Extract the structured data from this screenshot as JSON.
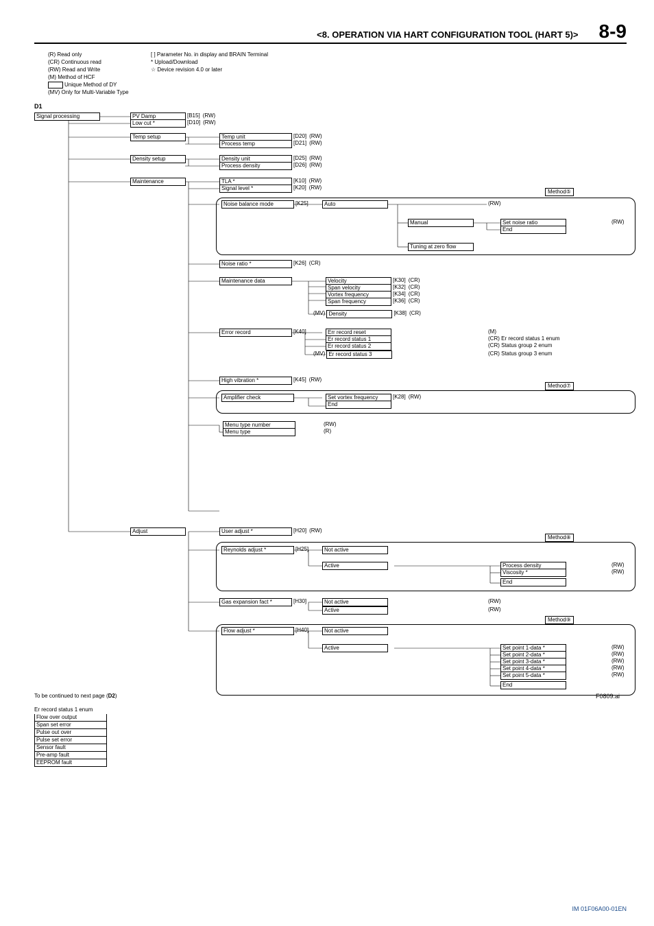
{
  "header": {
    "section": "<8.  OPERATION VIA HART CONFIGURATION TOOL (HART 5)>",
    "page": "8-9"
  },
  "legend": {
    "r": "(R) Read only",
    "cr": "(CR) Continuous read",
    "rw": "(RW) Read and Write",
    "m": "(M) Method of HCF",
    "dy": "Unique Method of DY",
    "mv": "(MV) Only for Multi-Variable Type",
    "bracket": "[    ] Parameter No. in display and BRAIN Terminal",
    "star": "*  Upload/Download",
    "rev": "☆ Device revision 4.0 or later"
  },
  "section": "D1",
  "root": "Signal processing",
  "lvl1": {
    "pvdamp": {
      "label": "PV Damp",
      "code": "[B15]",
      "attr": "(RW)"
    },
    "lowcut": {
      "label": "Low cut *",
      "code": "[D10]",
      "attr": "(RW)"
    },
    "tempsetup": "Temp setup",
    "densitysetup": "Density setup",
    "maint": "Maintenance",
    "adjust": "Adjust"
  },
  "temp": {
    "unit": {
      "label": "Temp unit",
      "code": "[D20]",
      "attr": "(RW)"
    },
    "proc": {
      "label": "Process temp",
      "code": "[D21]",
      "attr": "(RW)"
    }
  },
  "density": {
    "unit": {
      "label": "Density unit",
      "code": "[D25]",
      "attr": "(RW)"
    },
    "proc": {
      "label": "Process density",
      "code": "[D26]",
      "attr": "(RW)"
    }
  },
  "maint": {
    "tla": {
      "label": "TLA *",
      "code": "[K10]",
      "attr": "(RW)"
    },
    "sig": {
      "label": "Signal level *",
      "code": "[K20]",
      "attr": "(RW)"
    },
    "nbm": {
      "label": "Noise balance mode",
      "code": "[K25]"
    },
    "nbm_auto": "Auto",
    "nbm_auto_attr": "(RW)",
    "nbm_manual": "Manual",
    "nbm_setnoise": "Set noise ratio",
    "nbm_setnoise_attr": "(RW)",
    "nbm_end": "End",
    "nbm_tuning": "Tuning at zero flow",
    "nratio": {
      "label": "Noise ratio *",
      "code": "[K26]",
      "attr": "(CR)"
    },
    "mdata": {
      "label": "Maintenance data"
    },
    "md": {
      "vel": {
        "label": "Velocity",
        "code": "[K30]",
        "attr": "(CR)"
      },
      "svel": {
        "label": "Span velocity",
        "code": "[K32]",
        "attr": "(CR)"
      },
      "vf": {
        "label": "Vortex frequency",
        "code": "[K34]",
        "attr": "(CR)"
      },
      "sf": {
        "label": "Span frequency",
        "code": "[K36]",
        "attr": "(CR)"
      },
      "den": {
        "pre": "(MV)",
        "label": "Density",
        "code": "[K38]",
        "attr": "(CR)"
      }
    },
    "err": {
      "label": "Error record",
      "code": "[K40]"
    },
    "er": {
      "reset": {
        "label": "Err record reset",
        "attr": "(M)"
      },
      "s1": {
        "label": "Er record status 1",
        "attr": "(CR) Er record status 1 enum"
      },
      "s2": {
        "label": "Er record status 2",
        "attr": "(CR) Status group 2 enum"
      },
      "s3": {
        "pre": "(MV)",
        "label": "Er record status 3",
        "attr": "(CR) Status group 3 enum"
      }
    },
    "hv": {
      "label": "High vibration *",
      "code": "[K45]",
      "attr": "(RW)"
    },
    "amp": {
      "label": "Amplifier check"
    },
    "amp_svf": {
      "label": "Set vortex frequency",
      "code": "[K28]",
      "attr": "(RW)"
    },
    "amp_end": "End",
    "mtn": {
      "label": "Menu type number",
      "attr": "(RW)"
    },
    "mt": {
      "label": "Menu type",
      "attr": "(R)"
    }
  },
  "method": {
    "m5": "Method⑤",
    "m7": "Method⑦",
    "m8": "Method⑧",
    "m9": "Method⑨"
  },
  "adjust": {
    "user": {
      "label": "User adjust *",
      "code": "[H20]",
      "attr": "(RW)"
    },
    "rey": {
      "label": "Reynolds adjust *",
      "code": "[H25]"
    },
    "rey_na": "Not active",
    "rey_a": "Active",
    "rey_pd": {
      "label": "Process density",
      "attr": "(RW)"
    },
    "rey_vis": {
      "label": "Viscosity *",
      "attr": "(RW)"
    },
    "rey_end": "End",
    "gef": {
      "label": "Gas expansion fact *",
      "code": "[H30]"
    },
    "gef_na": {
      "label": "Not active",
      "attr": "(RW)"
    },
    "gef_a": {
      "label": "Active",
      "attr": "(RW)"
    },
    "flow": {
      "label": "Flow adjust *",
      "code": "[H40]"
    },
    "flow_na": "Not active",
    "flow_a": "Active",
    "sp1": {
      "label": "Set point 1-data *",
      "attr": "(RW)"
    },
    "sp2": {
      "label": "Set point 2-data *",
      "attr": "(RW)"
    },
    "sp3": {
      "label": "Set point 3-data *",
      "attr": "(RW)"
    },
    "sp4": {
      "label": "Set point 4-data *",
      "attr": "(RW)"
    },
    "sp5": {
      "label": "Set point 5-data *",
      "attr": "(RW)"
    },
    "sp_end": "End"
  },
  "continued": "To be continued to next page (",
  "continued_bold": "D2",
  "continued_end": ")",
  "enum": {
    "title": "Er record status 1 enum",
    "r1": "Flow over output",
    "r2": "Span set error",
    "r3": "Pulse out over",
    "r4": "Pulse set error",
    "r5": "Sensor fault",
    "r6": "Pre-amp fault",
    "r7": "EEPROM fault"
  },
  "figref": "F0809.ai",
  "footer": "IM 01F06A00-01EN"
}
